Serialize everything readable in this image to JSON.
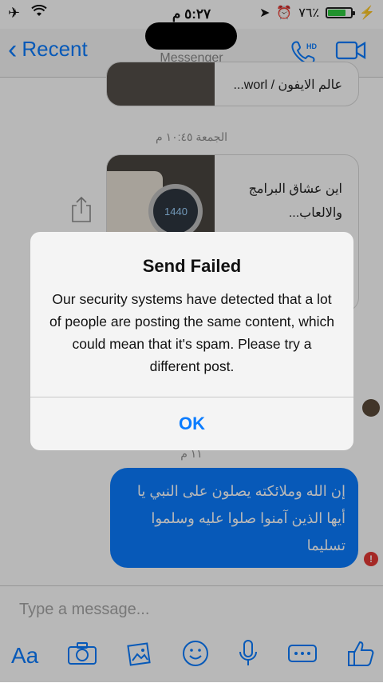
{
  "status_bar": {
    "time": "٥:٢٧ م",
    "battery": "٧٦٪"
  },
  "nav": {
    "back_label": "Recent",
    "subtitle": "Messenger"
  },
  "chat": {
    "cards": [
      {
        "text": "عالم الايفون / worl..."
      },
      {
        "text": "اين عشاق البرامج والالعاب..."
      }
    ],
    "timestamps": [
      "الجمعة ١٠:٤٥ م",
      "١١ م"
    ],
    "bubble_text": "إن الله وملائكته يصلون على النبي يا أيها الذين آمنوا صلوا عليه وسلموا تسليما"
  },
  "input": {
    "placeholder": "Type a message...",
    "aa_label": "Aa"
  },
  "alert": {
    "title": "Send Failed",
    "message": "Our security systems have detected that a lot of people are posting the same content, which could mean that it's spam. Please try a different post.",
    "ok_label": "OK"
  },
  "icons": {
    "airplane": "airplane-icon",
    "wifi": "wifi-icon",
    "location": "location-arrow-icon",
    "alarm": "alarm-icon",
    "charging": "charging-icon"
  }
}
